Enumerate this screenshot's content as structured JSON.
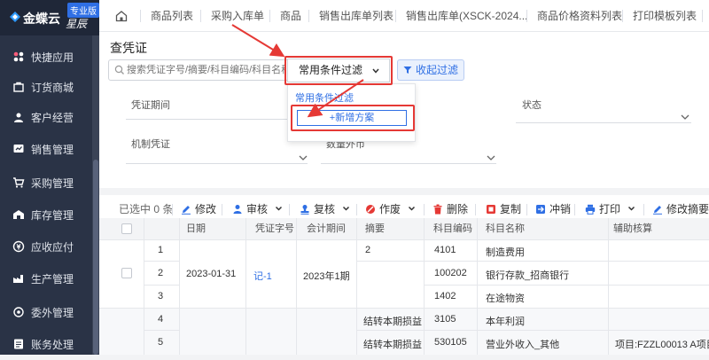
{
  "sidebar": {
    "brand": "金蝶云",
    "edition": "专业版",
    "product": "星辰",
    "items": [
      {
        "label": "快捷应用",
        "icon": "apps-icon"
      },
      {
        "label": "订货商城",
        "icon": "shop-icon"
      },
      {
        "label": "客户经营",
        "icon": "customer-icon"
      },
      {
        "label": "销售管理",
        "icon": "sales-icon"
      },
      {
        "label": "采购管理",
        "icon": "cart-icon"
      },
      {
        "label": "库存管理",
        "icon": "warehouse-icon"
      },
      {
        "label": "应收应付",
        "icon": "money-icon"
      },
      {
        "label": "生产管理",
        "icon": "production-icon"
      },
      {
        "label": "委外管理",
        "icon": "outsource-icon"
      },
      {
        "label": "账务处理",
        "icon": "ledger-icon"
      }
    ]
  },
  "tabs": [
    "商品列表",
    "采购入库单",
    "商品",
    "销售出库单列表",
    "销售出库单(XSCK-2024...",
    "商品价格资料列表",
    "打印模板列表"
  ],
  "page": {
    "title": "查凭证",
    "search_placeholder": "搜索凭证字号/摘要/科目编码/科目名称",
    "filter_select": "常用条件过滤",
    "collapse_label": "收起过滤"
  },
  "dropdown": {
    "option": "常用条件过滤",
    "add_scheme": "+新增方案"
  },
  "filters": {
    "period": "凭证期间",
    "status": "状态",
    "made_by": "机制凭证",
    "currency": "数量外币"
  },
  "toolbar": {
    "selected": "已选中 0 条",
    "edit": "修改",
    "audit": "审核",
    "recheck": "复核",
    "void": "作废",
    "delete": "删除",
    "copy": "复制",
    "reverse": "冲销",
    "print": "打印",
    "edit_summary": "修改摘要"
  },
  "table": {
    "headers": [
      "日期",
      "凭证字号",
      "会计期间",
      "摘要",
      "科目编码",
      "科目名称",
      "辅助核算"
    ],
    "group": {
      "date": "2023-01-31",
      "voucher": "记-1",
      "period": "2023年1期"
    },
    "rows": [
      {
        "no": "1",
        "summary": "2",
        "code": "4101",
        "name": "制造费用",
        "aux": ""
      },
      {
        "no": "2",
        "summary": "",
        "code": "100202",
        "name": "银行存款_招商银行",
        "aux": ""
      },
      {
        "no": "3",
        "summary": "",
        "code": "1402",
        "name": "在途物资",
        "aux": ""
      },
      {
        "no": "4",
        "summary": "结转本期损益",
        "code": "3105",
        "name": "本年利润",
        "aux": ""
      },
      {
        "no": "5",
        "summary": "结转本期损益",
        "code": "530105",
        "name": "营业外收入_其他",
        "aux": "项目:FZZL00013 A项目"
      }
    ]
  },
  "colors": {
    "accent": "#2f6fe4",
    "sidebar": "#2a3346",
    "highlight": "#e53935"
  }
}
